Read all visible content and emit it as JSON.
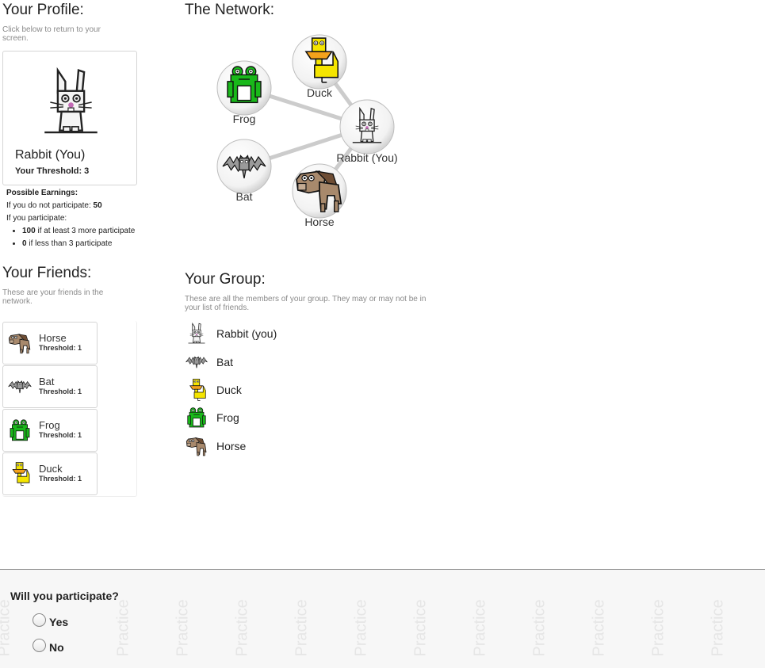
{
  "profile": {
    "heading": "Your Profile:",
    "hint": "Click below to return to your screen.",
    "name": "Rabbit (You)",
    "threshold_label": "Your Threshold: 3",
    "icon": "rabbit-icon"
  },
  "earnings": {
    "title": "Possible Earnings:",
    "no_part_prefix": "If you do not participate: ",
    "no_part_value": "50",
    "part_label": "If you participate:",
    "bullet1_value": "100",
    "bullet1_text": " if at least 3 more participate",
    "bullet2_value": "0",
    "bullet2_text": " if less than 3 participate"
  },
  "network": {
    "heading": "The Network:",
    "nodes": [
      {
        "label": "Duck",
        "icon": "duck-icon"
      },
      {
        "label": "Frog",
        "icon": "frog-icon"
      },
      {
        "label": "Rabbit (You)",
        "icon": "rabbit-icon"
      },
      {
        "label": "Bat",
        "icon": "bat-icon"
      },
      {
        "label": "Horse",
        "icon": "horse-icon"
      }
    ]
  },
  "friends": {
    "heading": "Your Friends:",
    "hint": "These are your friends in the network.",
    "items": [
      {
        "name": "Horse",
        "threshold": "Threshold: 1",
        "icon": "horse-icon"
      },
      {
        "name": "Bat",
        "threshold": "Threshold: 1",
        "icon": "bat-icon"
      },
      {
        "name": "Frog",
        "threshold": "Threshold: 1",
        "icon": "frog-icon"
      },
      {
        "name": "Duck",
        "threshold": "Threshold: 1",
        "icon": "duck-icon"
      }
    ]
  },
  "group": {
    "heading": "Your Group:",
    "hint": "These are all the members of your group. They may or may not be in your list of friends.",
    "members": [
      {
        "name": "Rabbit (you)",
        "icon": "rabbit-icon"
      },
      {
        "name": "Bat",
        "icon": "bat-icon"
      },
      {
        "name": "Duck",
        "icon": "duck-icon"
      },
      {
        "name": "Frog",
        "icon": "frog-icon"
      },
      {
        "name": "Horse",
        "icon": "horse-icon"
      }
    ]
  },
  "decision": {
    "question": "Will you participate?",
    "yes_label": "Yes",
    "no_label": "No",
    "watermark": "Practice"
  },
  "colors": {
    "frog": "#19b81a",
    "duck": "#f5e500",
    "duck_bill": "#f4a21b",
    "horse": "#a8896c",
    "bat": "#9a9a9a",
    "edge": "#cccccc"
  }
}
